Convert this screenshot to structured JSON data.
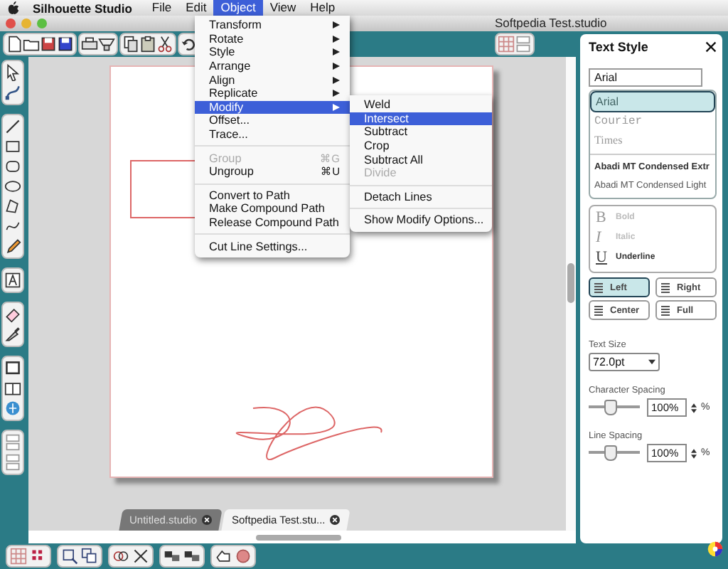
{
  "menubar": {
    "app": "Silhouette Studio",
    "items": [
      {
        "label": "File",
        "selected": false
      },
      {
        "label": "Edit",
        "selected": false
      },
      {
        "label": "Object",
        "selected": true
      },
      {
        "label": "View",
        "selected": false
      },
      {
        "label": "Help",
        "selected": false
      }
    ]
  },
  "window": {
    "title": "Softpedia Test.studio"
  },
  "object_menu": {
    "items": [
      {
        "kind": "submenu",
        "label": "Transform",
        "selected": false,
        "disabled": false
      },
      {
        "kind": "submenu",
        "label": "Rotate",
        "selected": false,
        "disabled": false
      },
      {
        "kind": "submenu",
        "label": "Style",
        "selected": false,
        "disabled": false
      },
      {
        "kind": "submenu",
        "label": "Arrange",
        "selected": false,
        "disabled": false
      },
      {
        "kind": "submenu",
        "label": "Align",
        "selected": false,
        "disabled": false
      },
      {
        "kind": "submenu",
        "label": "Replicate",
        "selected": false,
        "disabled": false
      },
      {
        "kind": "submenu",
        "label": "Modify",
        "selected": true,
        "disabled": false
      },
      {
        "kind": "item",
        "label": "Offset...",
        "selected": false,
        "disabled": false
      },
      {
        "kind": "item",
        "label": "Trace...",
        "selected": false,
        "disabled": false
      },
      {
        "kind": "separator"
      },
      {
        "kind": "item",
        "label": "Group",
        "shortcut": "⌘G",
        "selected": false,
        "disabled": true
      },
      {
        "kind": "item",
        "label": "Ungroup",
        "shortcut": "⌘U",
        "selected": false,
        "disabled": false
      },
      {
        "kind": "separator"
      },
      {
        "kind": "item",
        "label": "Convert to Path",
        "selected": false,
        "disabled": false
      },
      {
        "kind": "item",
        "label": "Make Compound Path",
        "selected": false,
        "disabled": false
      },
      {
        "kind": "item",
        "label": "Release Compound Path",
        "selected": false,
        "disabled": false
      },
      {
        "kind": "separator"
      },
      {
        "kind": "item",
        "label": "Cut Line Settings...",
        "selected": false,
        "disabled": false
      }
    ]
  },
  "modify_menu": {
    "items": [
      {
        "kind": "item",
        "label": "Weld",
        "selected": false,
        "disabled": false
      },
      {
        "kind": "item",
        "label": "Intersect",
        "selected": true,
        "disabled": false
      },
      {
        "kind": "item",
        "label": "Subtract",
        "selected": false,
        "disabled": false
      },
      {
        "kind": "item",
        "label": "Crop",
        "selected": false,
        "disabled": false
      },
      {
        "kind": "item",
        "label": "Subtract All",
        "selected": false,
        "disabled": false
      },
      {
        "kind": "item",
        "label": "Divide",
        "selected": false,
        "disabled": true
      },
      {
        "kind": "separator"
      },
      {
        "kind": "item",
        "label": "Detach Lines",
        "selected": false,
        "disabled": false
      },
      {
        "kind": "separator"
      },
      {
        "kind": "item",
        "label": "Show Modify Options...",
        "selected": false,
        "disabled": false
      }
    ]
  },
  "document_tabs": [
    {
      "label": "Untitled.studio",
      "selected": false
    },
    {
      "label": "Softpedia Test.stu...",
      "selected": true
    }
  ],
  "text_style": {
    "title": "Text Style",
    "font_field": "Arial",
    "fonts": [
      {
        "label": "Arial",
        "selected": true
      },
      {
        "label": "Courier",
        "selected": false
      },
      {
        "label": "Times",
        "selected": false
      },
      {
        "label": "Abadi MT Condensed Extr",
        "selected": false
      },
      {
        "label": "Abadi MT Condensed Light",
        "selected": false
      }
    ],
    "styles": [
      {
        "glyph": "B",
        "label": "Bold",
        "disabled": true
      },
      {
        "glyph": "I",
        "label": "Italic",
        "disabled": true
      },
      {
        "glyph": "U",
        "label": "Underline",
        "disabled": false
      }
    ],
    "alignment": [
      {
        "label": "Left",
        "selected": true
      },
      {
        "label": "Right",
        "selected": false
      },
      {
        "label": "Center",
        "selected": false
      },
      {
        "label": "Full",
        "selected": false
      }
    ],
    "text_size": {
      "label": "Text Size",
      "value": "72.0pt"
    },
    "spacing": [
      {
        "label": "Character Spacing",
        "level": 0.42,
        "value": "100%",
        "unit": "%"
      },
      {
        "label": "Line Spacing",
        "level": 0.42,
        "value": "100%",
        "unit": "%"
      }
    ]
  }
}
